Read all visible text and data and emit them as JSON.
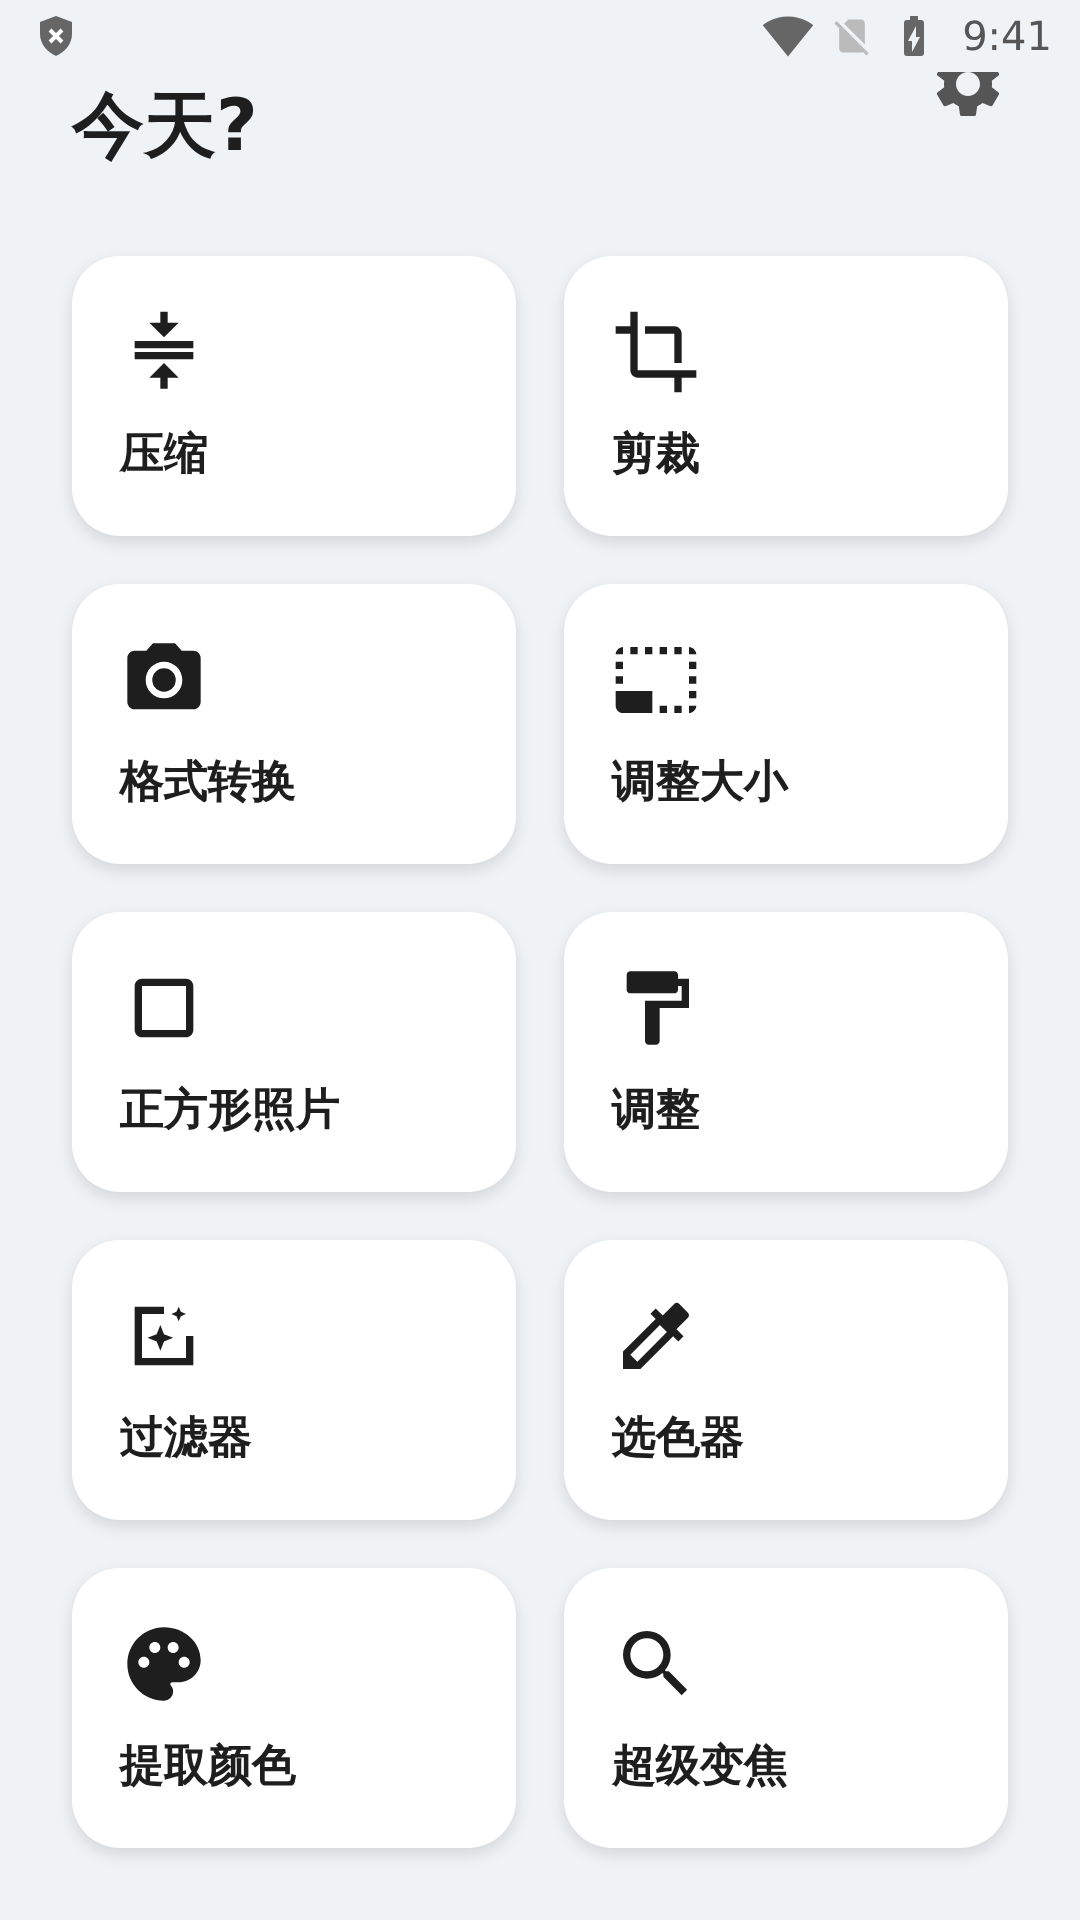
{
  "status_bar": {
    "time": "9:41"
  },
  "header": {
    "title": "今天?"
  },
  "tools": [
    {
      "label": "压缩"
    },
    {
      "label": "剪裁"
    },
    {
      "label": "格式转换"
    },
    {
      "label": "调整大小"
    },
    {
      "label": "正方形照片"
    },
    {
      "label": "调整"
    },
    {
      "label": "过滤器"
    },
    {
      "label": "选色器"
    },
    {
      "label": "提取颜色"
    },
    {
      "label": "超级变焦"
    }
  ]
}
